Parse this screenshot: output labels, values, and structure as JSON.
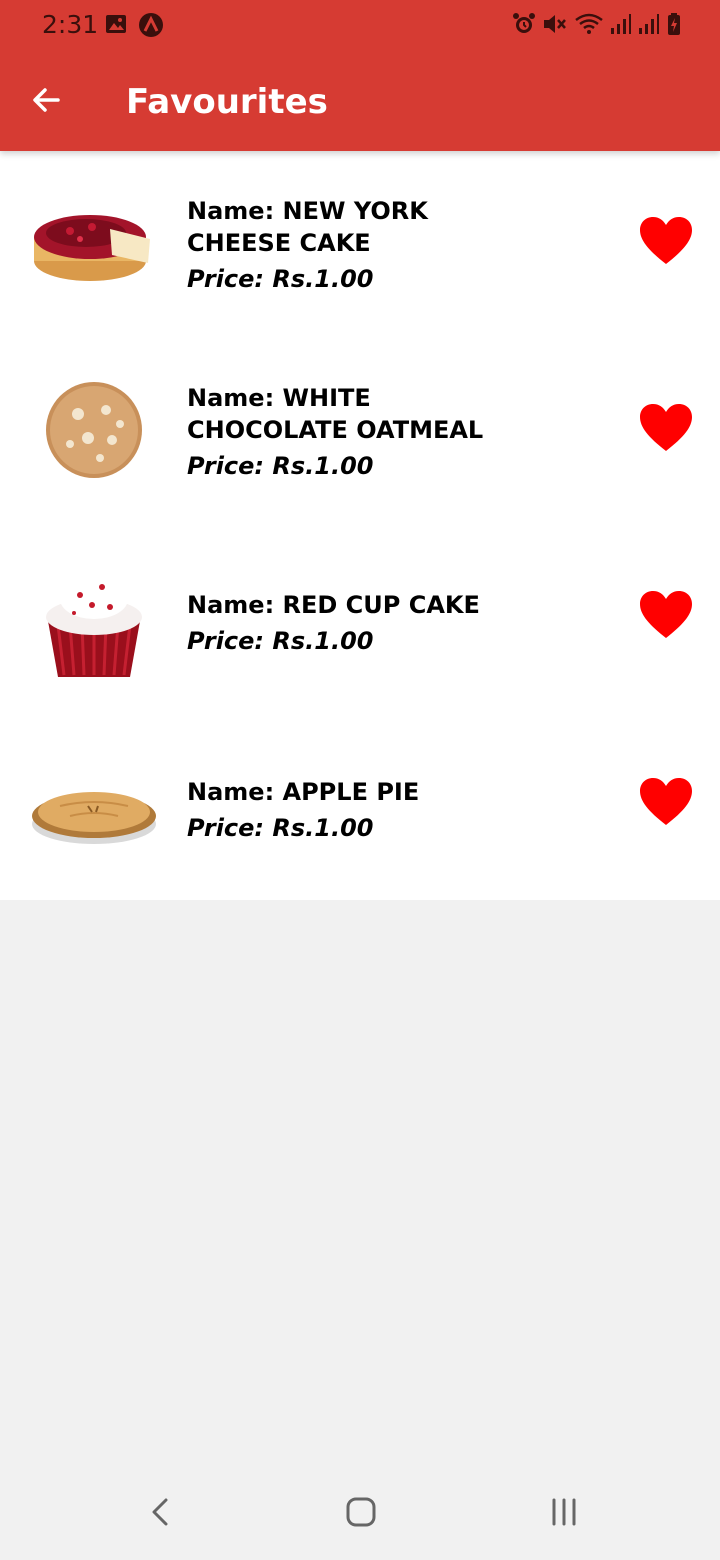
{
  "status_bar": {
    "time": "2:31",
    "left_icons": [
      "image-icon",
      "app-a-icon"
    ],
    "right_icons": [
      "alarm-icon",
      "mute-icon",
      "wifi-icon",
      "signal-icon",
      "signal-icon",
      "battery-charging-icon"
    ]
  },
  "app_bar": {
    "title": "Favourites",
    "back_icon": "arrow-back-icon",
    "color": "#d63b33"
  },
  "favourites": [
    {
      "name_line1": "Name: NEW YORK",
      "name_line2": "CHEESE CAKE",
      "price": "Price: Rs.1.00",
      "image": "cheesecake",
      "favourite": true
    },
    {
      "name_line1": "Name: WHITE",
      "name_line2": "CHOCOLATE OATMEAL",
      "price": "Price: Rs.1.00",
      "image": "cookie",
      "favourite": true
    },
    {
      "name_line1": "Name: RED CUP CAKE",
      "name_line2": "",
      "price": "Price: Rs.1.00",
      "image": "cupcake",
      "favourite": true
    },
    {
      "name_line1": "Name: APPLE PIE",
      "name_line2": "",
      "price": "Price: Rs.1.00",
      "image": "pie",
      "favourite": true
    }
  ],
  "heart_color": "#ff0000",
  "nav_bar": {
    "buttons": [
      "back-nav-icon",
      "home-nav-icon",
      "recents-nav-icon"
    ]
  }
}
